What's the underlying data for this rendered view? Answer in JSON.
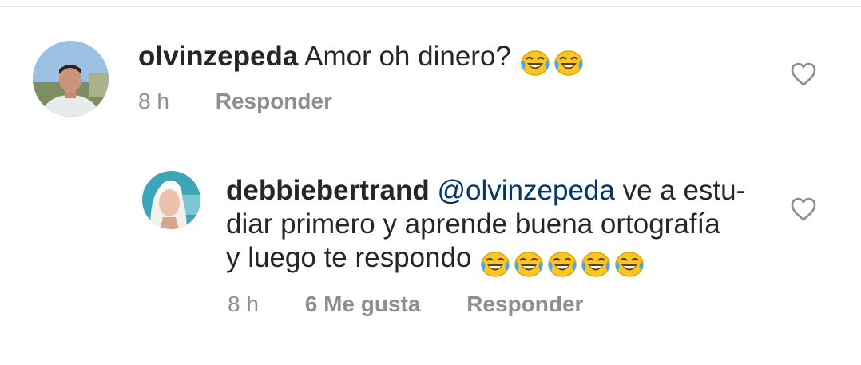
{
  "comments": [
    {
      "username": "olvinzepeda",
      "text": "Amor oh dinero?",
      "emoji": [
        "crying-laughing",
        "crying-laughing"
      ],
      "time": "8 h",
      "reply_label": "Responder"
    },
    {
      "username": "debbiebertrand",
      "mention": "@olvinzepeda",
      "line1": "ve a estu-",
      "line2": "diar primero y aprende buena ortografía",
      "line3": "y luego te respondo",
      "emoji": [
        "crying-laughing",
        "crying-laughing",
        "crying-laughing",
        "crying-laughing",
        "crying-laughing"
      ],
      "time": "8 h",
      "likes": "6 Me gusta",
      "reply_label": "Responder"
    }
  ],
  "icons": {
    "like": "heart-outline-icon",
    "emoji": "face-with-tears-of-joy"
  },
  "colors": {
    "text": "#262626",
    "meta": "#8e8e8e",
    "mention": "#00376b"
  }
}
